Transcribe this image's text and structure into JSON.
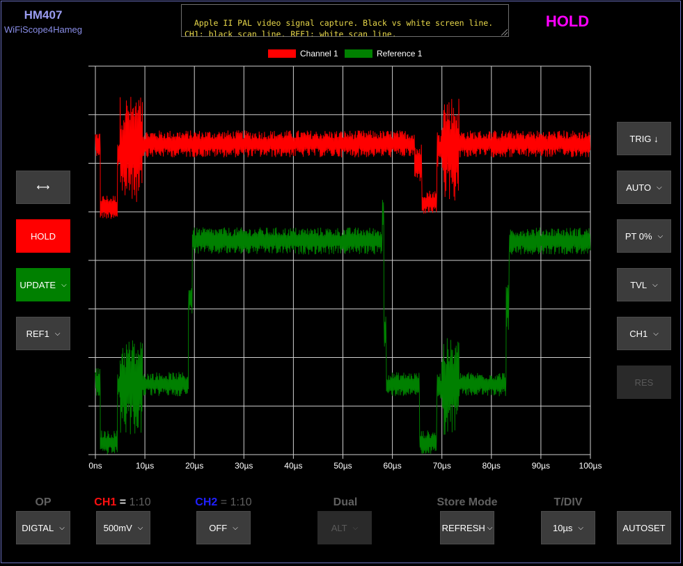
{
  "brand": {
    "model": "HM407",
    "subtitle": "WiFiScope4Hameg"
  },
  "notes": "Apple II PAL video signal capture. Black vs white screen line.\nCH1: black scan line. REF1: white scan line.",
  "status": "HOLD",
  "legend": [
    {
      "label": "Channel 1",
      "color": "#ff0000"
    },
    {
      "label": "Reference 1",
      "color": "#008000"
    }
  ],
  "left_buttons": {
    "expand": "⟷",
    "hold": "HOLD",
    "update": "UPDATE",
    "ref": "REF1"
  },
  "right_buttons": {
    "trig": "TRIG ↓",
    "mode": "AUTO",
    "pretrigger": "PT 0%",
    "source_type": "TVL",
    "channel": "CH1",
    "reset": "RES"
  },
  "bottom": {
    "op_label": "OP",
    "op_value": "DIGTAL",
    "ch1_label": "CH1",
    "ch1_ratio": "1:10",
    "ch1_value": "500mV",
    "ch2_label": "CH2",
    "ch2_ratio": "1:10",
    "ch2_value": "OFF",
    "dual_label": "Dual",
    "dual_value": "ALT",
    "store_label": "Store Mode",
    "store_value": "REFRESH",
    "tdiv_label": "T/DIV",
    "tdiv_value": "10µs",
    "autoset": "AUTOSET",
    "equals": "="
  },
  "chart_data": {
    "type": "line",
    "x_unit": "µs",
    "xlim": [
      0,
      100
    ],
    "x_ticks": [
      "0ns",
      "10µs",
      "20µs",
      "30µs",
      "40µs",
      "50µs",
      "60µs",
      "70µs",
      "80µs",
      "90µs",
      "100µs"
    ],
    "ylim": [
      0,
      8
    ],
    "grid": true,
    "legend_position": "top",
    "series": [
      {
        "name": "Channel 1",
        "color": "#ff0000",
        "segments": [
          {
            "x0": 0,
            "x1": 1,
            "level": 6.4,
            "noise": 0.25
          },
          {
            "x0": 1,
            "x1": 4.5,
            "level": 5.1,
            "noise": 0.25
          },
          {
            "x0": 4.5,
            "x1": 5,
            "level": 6.2,
            "noise": 0.3
          },
          {
            "x0": 5,
            "x1": 9.5,
            "level": 6.3,
            "noise": 1.1
          },
          {
            "x0": 9.5,
            "x1": 64.5,
            "level": 6.4,
            "noise": 0.28
          },
          {
            "x0": 64.5,
            "x1": 66,
            "level": 6.0,
            "noise": 0.4
          },
          {
            "x0": 66,
            "x1": 69,
            "level": 5.2,
            "noise": 0.25
          },
          {
            "x0": 69,
            "x1": 70,
            "level": 6.3,
            "noise": 0.4
          },
          {
            "x0": 70,
            "x1": 73.5,
            "level": 6.3,
            "noise": 1.1
          },
          {
            "x0": 73.5,
            "x1": 100,
            "level": 6.4,
            "noise": 0.28
          }
        ]
      },
      {
        "name": "Reference 1",
        "color": "#008000",
        "segments": [
          {
            "x0": 0,
            "x1": 1,
            "level": 1.5,
            "noise": 0.3
          },
          {
            "x0": 1,
            "x1": 4.5,
            "level": 0.25,
            "noise": 0.25
          },
          {
            "x0": 4.5,
            "x1": 5,
            "level": 1.4,
            "noise": 0.3
          },
          {
            "x0": 5,
            "x1": 9.5,
            "level": 1.4,
            "noise": 1.0
          },
          {
            "x0": 9.5,
            "x1": 18.8,
            "level": 1.45,
            "noise": 0.25
          },
          {
            "x0": 18.8,
            "x1": 19.6,
            "level": 3.2,
            "noise": 0.3
          },
          {
            "x0": 19.6,
            "x1": 58,
            "level": 4.4,
            "noise": 0.28
          },
          {
            "x0": 58,
            "x1": 58.3,
            "level": 5.0,
            "noise": 0.3
          },
          {
            "x0": 58.3,
            "x1": 58.8,
            "level": 2.5,
            "noise": 0.5
          },
          {
            "x0": 58.8,
            "x1": 65.5,
            "level": 1.45,
            "noise": 0.25
          },
          {
            "x0": 65.5,
            "x1": 69,
            "level": 0.25,
            "noise": 0.25
          },
          {
            "x0": 69,
            "x1": 70,
            "level": 1.4,
            "noise": 0.3
          },
          {
            "x0": 70,
            "x1": 73.5,
            "level": 1.4,
            "noise": 1.0
          },
          {
            "x0": 73.5,
            "x1": 83,
            "level": 1.45,
            "noise": 0.25
          },
          {
            "x0": 83,
            "x1": 83.6,
            "level": 3.0,
            "noise": 0.5
          },
          {
            "x0": 83.6,
            "x1": 100,
            "level": 4.4,
            "noise": 0.28
          }
        ]
      }
    ]
  }
}
